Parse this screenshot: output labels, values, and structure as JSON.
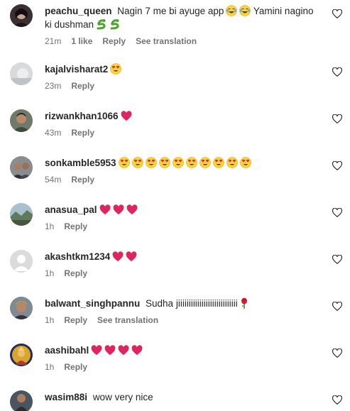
{
  "comments": [
    {
      "username": "peachu_queen",
      "text": "Nagin 7 me bi ayuge app",
      "text2": "Yamini nagino",
      "text3": "ki dushman",
      "time": "21m",
      "likes": "1 like",
      "reply": "Reply",
      "translate": "See translation",
      "avatar": "dark-hair"
    },
    {
      "username": "kajalvisharat2",
      "text": "",
      "time": "23m",
      "reply": "Reply",
      "avatar": "light-grey"
    },
    {
      "username": "rizwankhan1066",
      "text": "",
      "time": "43m",
      "reply": "Reply",
      "avatar": "man-photo"
    },
    {
      "username": "sonkamble5953",
      "text": "",
      "time": "54m",
      "reply": "Reply",
      "avatar": "group-photo"
    },
    {
      "username": "anasua_pal",
      "text": "",
      "time": "1h",
      "reply": "Reply",
      "avatar": "landscape"
    },
    {
      "username": "akashtkm1234",
      "text": "",
      "time": "1h",
      "reply": "Reply",
      "avatar": "default"
    },
    {
      "username": "balwant_singhpannu",
      "text": "Sudha jiiiiiiiiiiiiiiiiiiiiiiiiiiii",
      "time": "1h",
      "reply": "Reply",
      "translate": "See translation",
      "avatar": "man-turban"
    },
    {
      "username": "aashibahl",
      "text": "",
      "time": "1h",
      "reply": "Reply",
      "avatar": "deity"
    },
    {
      "username": "wasim88i",
      "text": "wow very nice",
      "avatar": "man-standing"
    }
  ],
  "icons": {
    "like": "heart-outline-icon",
    "emoji_heart_eyes": "heart-eyes-emoji",
    "emoji_red_heart": "red-heart-emoji",
    "emoji_laugh": "tears-of-joy-emoji",
    "emoji_snake": "snake-emoji",
    "emoji_rose": "rose-emoji"
  },
  "colors": {
    "username": "#262626",
    "meta": "#737373",
    "heart_red": "#e0245e"
  }
}
